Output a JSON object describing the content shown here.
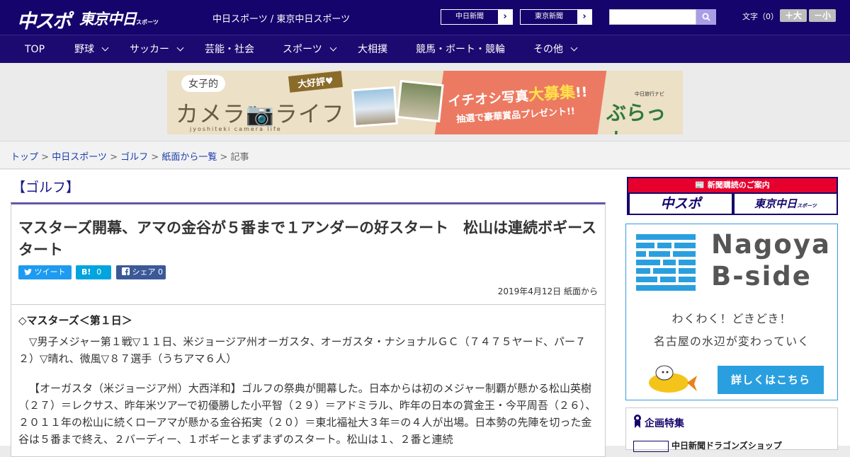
{
  "header": {
    "logo_chuspo": "中スポ",
    "logo_tokyo": "東京中日",
    "logo_tokyo_small": "スポーツ",
    "site_links": "中日スポーツ / 東京中日スポーツ",
    "paper_buttons": [
      {
        "label": "中日新聞",
        "arrow": "›"
      },
      {
        "label": "東京新聞",
        "arrow": "›"
      }
    ],
    "search": {
      "placeholder": "",
      "icon": "search-icon"
    },
    "fontsize": {
      "label": "文字（0）",
      "bigger": "＋大",
      "smaller": "－小"
    }
  },
  "nav": {
    "items": [
      {
        "label": "TOP",
        "dropdown": false
      },
      {
        "label": "野球",
        "dropdown": true
      },
      {
        "label": "サッカー",
        "dropdown": true
      },
      {
        "label": "芸能・社会",
        "dropdown": false
      },
      {
        "label": "スポーツ",
        "dropdown": true
      },
      {
        "label": "大相撲",
        "dropdown": false
      },
      {
        "label": "競馬・ボート・競輪",
        "dropdown": false
      },
      {
        "label": "その他",
        "dropdown": true
      }
    ]
  },
  "banner": {
    "joshi": "女子的",
    "camera": "カメラ📷ライフ",
    "sub": "jyoshiteki camera life",
    "daikohyo": "大好評♥",
    "ichioshi_pre": "イチオシ写真",
    "ichioshi_big": "大募集",
    "ichioshi_post": "!!",
    "present": "抽選で豪華賞品プレゼント!!",
    "tabinavi": "中日旅行ナビ",
    "burattabi": "ぶらっ人"
  },
  "breadcrumb": {
    "items": [
      "トップ",
      "中日スポーツ",
      "ゴルフ",
      "紙面から一覧"
    ],
    "sep": ">",
    "current": "記事"
  },
  "article": {
    "category": "【ゴルフ】",
    "headline": "マスターズ開幕、アマの金谷が５番まで１アンダーの好スタート　松山は連続ボギースタート",
    "share": {
      "tweet": "ツイート",
      "hatena_label": "B!",
      "hatena_count": "0",
      "facebook_label": "シェア",
      "facebook_count": "0"
    },
    "date": "2019年4月12日 紙面から",
    "subtitle": "◇マスターズ＜第１日＞",
    "paragraphs": [
      "▽男子メジャー第１戦▽１１日、米ジョージア州オーガスタ、オーガスタ・ナショナルＧＣ（７４７５ヤード、パー７２）▽晴れ、微風▽８７選手（うちアマ６人）",
      "【オーガスタ（米ジョージア州）大西洋和】ゴルフの祭典が開幕した。日本からは初のメジャー制覇が懸かる松山英樹（２７）＝レクサス、昨年米ツアーで初優勝した小平智（２９）＝アドミラル、昨年の日本の賞金王・今平周吾（２６）、２０１１年の松山に続くローアマが懸かる金谷拓実（２０）＝東北福祉大３年＝の４人が出場。日本勢の先陣を切った金谷は５番まで終え、２バーディー、１ボギーとまずまずのスタート。松山は１、２番と連続"
    ]
  },
  "sidebar": {
    "subscribe": {
      "head": "📰 新聞購読のご案内",
      "chuspo": "中スポ",
      "tokyo": "東京中日",
      "tokyo_small": "スポーツ"
    },
    "bside": {
      "title_1": "Nagoya",
      "title_2": "B-side",
      "catch_1": "わくわく！どきどき！",
      "catch_2": "名古屋の水辺が変わっていく",
      "button": "詳しくはこちら"
    },
    "special": {
      "title": "企画特集",
      "item": "中日新聞ドラゴンズショップ"
    }
  },
  "colors": {
    "header_bg": "#15046b",
    "accent_red": "#e6002d",
    "twitter": "#1d9bf0",
    "hatena": "#00a4de",
    "facebook": "#3b5998",
    "link": "#1a3caa"
  }
}
